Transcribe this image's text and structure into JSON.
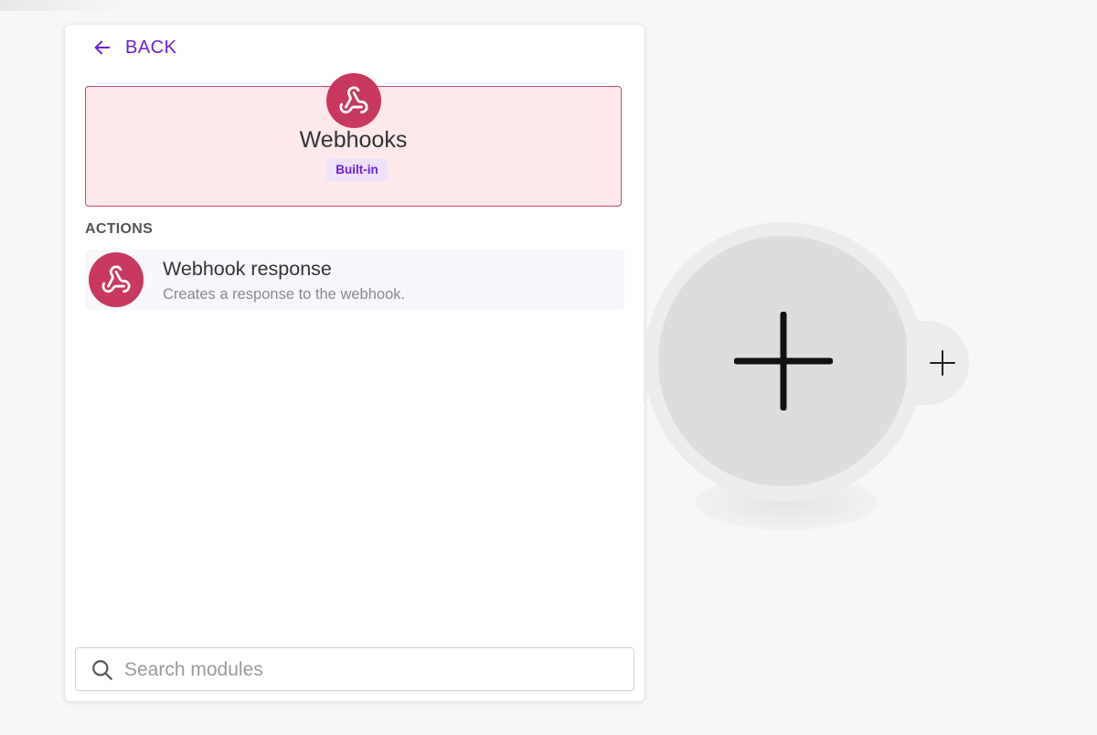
{
  "panel": {
    "back_label": "BACK",
    "app": {
      "name": "Webhooks",
      "badge": "Built-in",
      "icon": "webhook-icon",
      "brand_color": "#c8385f"
    },
    "actions_heading": "ACTIONS",
    "actions": [
      {
        "title": "Webhook response",
        "description": "Creates a response to the webhook.",
        "icon": "webhook-icon"
      }
    ],
    "search": {
      "placeholder": "Search modules",
      "value": ""
    }
  },
  "canvas": {
    "add_module_icon": "plus-icon",
    "add_next_icon": "plus-icon"
  },
  "colors": {
    "accent": "#6d1fd6",
    "app_card_bg": "#fde9ec",
    "app_card_border": "#c9456e",
    "badge_bg": "#eee2fb"
  }
}
